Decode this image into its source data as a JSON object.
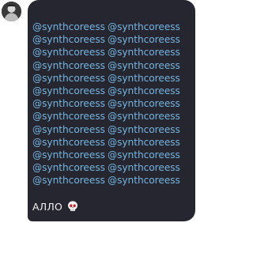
{
  "avatar": {
    "icon": "user-avatar-icon"
  },
  "message": {
    "mention_rows": [
      [
        "@synthcoreess",
        "@synthcoreess"
      ],
      [
        "@synthcoreess",
        "@synthcoreess"
      ],
      [
        "@synthcoreess",
        "@synthcoreess"
      ],
      [
        "@synthcoreess",
        "@synthcoreess"
      ],
      [
        "@synthcoreess",
        "@synthcoreess"
      ],
      [
        "@synthcoreess",
        "@synthcoreess"
      ],
      [
        "@synthcoreess",
        "@synthcoreess"
      ],
      [
        "@synthcoreess",
        "@synthcoreess"
      ],
      [
        "@synthcoreess",
        "@synthcoreess"
      ],
      [
        "@synthcoreess",
        "@synthcoreess"
      ],
      [
        "@synthcoreess",
        "@synthcoreess"
      ],
      [
        "@synthcoreess",
        "@synthcoreess"
      ],
      [
        "@synthcoreess",
        "@synthcoreess"
      ]
    ],
    "text": "АЛЛО",
    "emoji": "skull-emoji-icon"
  },
  "colors": {
    "bubble_bg": "#262630",
    "mention": "#74b4e0",
    "text": "#f0f0f4"
  }
}
